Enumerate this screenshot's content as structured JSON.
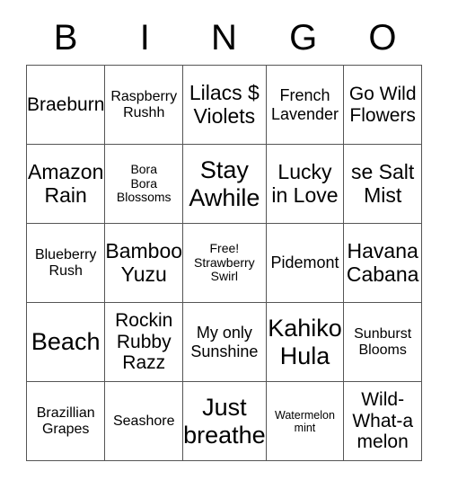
{
  "card": {
    "title": "BINGO",
    "header_letters": [
      "B",
      "I",
      "N",
      "G",
      "O"
    ],
    "border_color": "#555555",
    "background_color": "#ffffff",
    "text_color": "#000000",
    "rows": 5,
    "columns": 5,
    "cells": [
      [
        {
          "text": "Braeburn",
          "size": "fs-l"
        },
        {
          "text": "Raspberry\nRushh",
          "size": "fs-s"
        },
        {
          "text": "Lilacs $\nViolets",
          "size": "fs-xl"
        },
        {
          "text": "French\nLavender",
          "size": "fs-m"
        },
        {
          "text": "Go Wild\nFlowers",
          "size": "fs-l"
        }
      ],
      [
        {
          "text": "Amazon\nRain",
          "size": "fs-xl"
        },
        {
          "text": "Bora\nBora\nBlossoms",
          "size": "fs-xs"
        },
        {
          "text": "Stay\nAwhile",
          "size": "fs-xxl"
        },
        {
          "text": "Lucky\nin Love",
          "size": "fs-xl"
        },
        {
          "text": "se Salt\nMist",
          "size": "fs-xl"
        }
      ],
      [
        {
          "text": "Blueberry\nRush",
          "size": "fs-s"
        },
        {
          "text": "Bamboo\nYuzu",
          "size": "fs-xl"
        },
        {
          "text": "Free!\nStrawberry\nSwirl",
          "size": "fs-xs",
          "free_space": true
        },
        {
          "text": "Pidemont",
          "size": "fs-m"
        },
        {
          "text": "Havana\nCabana",
          "size": "fs-xl"
        }
      ],
      [
        {
          "text": "Beach",
          "size": "fs-xxl"
        },
        {
          "text": "Rockin\nRubby\nRazz",
          "size": "fs-l"
        },
        {
          "text": "My only\nSunshine",
          "size": "fs-m"
        },
        {
          "text": "Kahiko\nHula",
          "size": "fs-xxl"
        },
        {
          "text": "Sunburst\nBlooms",
          "size": "fs-s"
        }
      ],
      [
        {
          "text": "Brazillian\nGrapes",
          "size": "fs-s"
        },
        {
          "text": "Seashore",
          "size": "fs-s"
        },
        {
          "text": "Just\nbreathe",
          "size": "fs-xxl"
        },
        {
          "text": "Watermelon\nmint",
          "size": "fs-xxs"
        },
        {
          "text": "Wild-\nWhat-a\nmelon",
          "size": "fs-l"
        }
      ]
    ]
  }
}
